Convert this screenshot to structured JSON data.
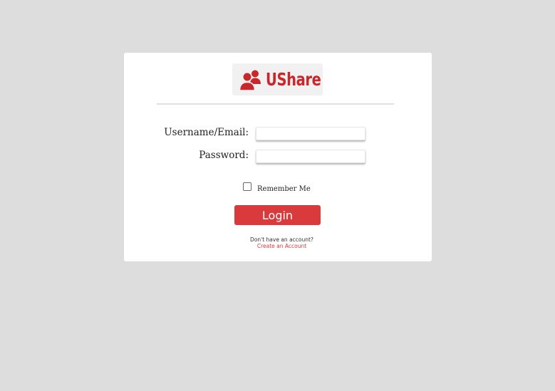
{
  "brand": {
    "name": "UShare",
    "icon": "users-icon",
    "color": "#c8282c"
  },
  "form": {
    "username_label": "Username/Email:",
    "username_value": "",
    "password_label": "Password:",
    "password_value": "",
    "remember_label": "Remember Me",
    "remember_checked": false,
    "login_label": "Login",
    "no_account_text": "Don't have an account?",
    "create_account_link": "Create an Account"
  },
  "colors": {
    "background": "#dddddd",
    "card": "#ffffff",
    "accent": "#d93a3c"
  }
}
